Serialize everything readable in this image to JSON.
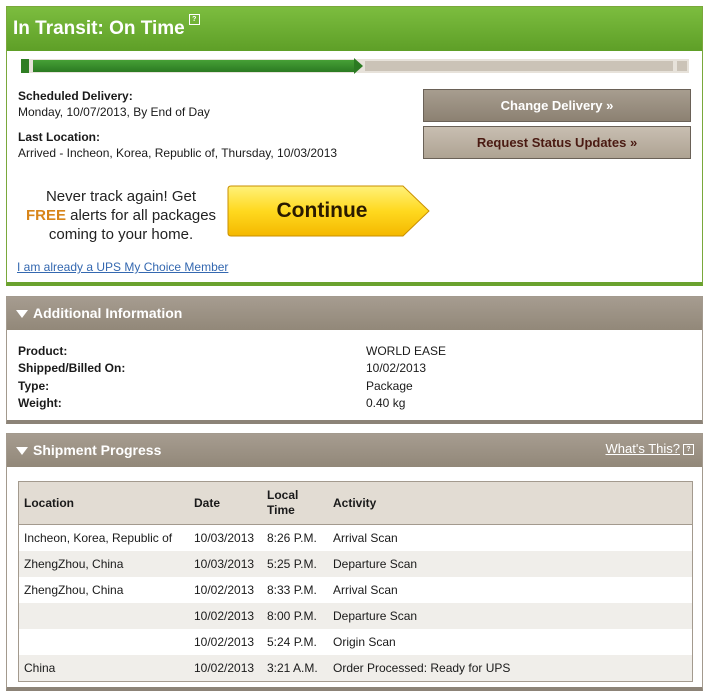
{
  "status": {
    "title": "In Transit: On Time",
    "progress_fraction": 0.5,
    "scheduled_label": "Scheduled Delivery:",
    "scheduled_value": "Monday, 10/07/2013, By End of Day",
    "last_location_label": "Last Location:",
    "last_location_value": "Arrived - Incheon, Korea, Republic of, Thursday, 10/03/2013",
    "change_delivery_button": "Change Delivery »",
    "request_updates_button": "Request Status Updates »",
    "promo_line1": "Never track again! Get",
    "promo_free": "FREE",
    "promo_line2_rest": " alerts for all packages",
    "promo_line3": "coming to your home.",
    "continue_button": "Continue",
    "member_link": "I am already a UPS My Choice Member"
  },
  "additional_info": {
    "title": "Additional Information",
    "rows": [
      {
        "label": "Product:",
        "value": "WORLD EASE"
      },
      {
        "label": "Shipped/Billed On:",
        "value": "10/02/2013"
      },
      {
        "label": "Type:",
        "value": "Package"
      },
      {
        "label": "Weight:",
        "value": "0.40 kg"
      }
    ]
  },
  "shipment_progress": {
    "title": "Shipment Progress",
    "whats_this": "What's This?",
    "columns": [
      "Location",
      "Date",
      "Local Time",
      "Activity"
    ],
    "rows": [
      {
        "location": "Incheon, Korea, Republic of",
        "date": "10/03/2013",
        "time": "8:26 P.M.",
        "activity": "Arrival Scan"
      },
      {
        "location": "ZhengZhou, China",
        "date": "10/03/2013",
        "time": "5:25 P.M.",
        "activity": "Departure Scan"
      },
      {
        "location": "ZhengZhou, China",
        "date": "10/02/2013",
        "time": "8:33 P.M.",
        "activity": "Arrival Scan"
      },
      {
        "location": "",
        "date": "10/02/2013",
        "time": "8:00 P.M.",
        "activity": "Departure Scan"
      },
      {
        "location": "",
        "date": "10/02/2013",
        "time": "5:24 P.M.",
        "activity": "Origin Scan"
      },
      {
        "location": "China",
        "date": "10/02/2013",
        "time": "3:21 A.M.",
        "activity": "Order Processed: Ready for UPS"
      }
    ]
  },
  "colors": {
    "status_green": "#6aa22e",
    "panel_tan": "#9a9083",
    "free_orange": "#d8851a",
    "link_blue": "#3468b0"
  },
  "icons": {
    "help": "help-icon",
    "collapse": "collapse-triangle-icon"
  }
}
